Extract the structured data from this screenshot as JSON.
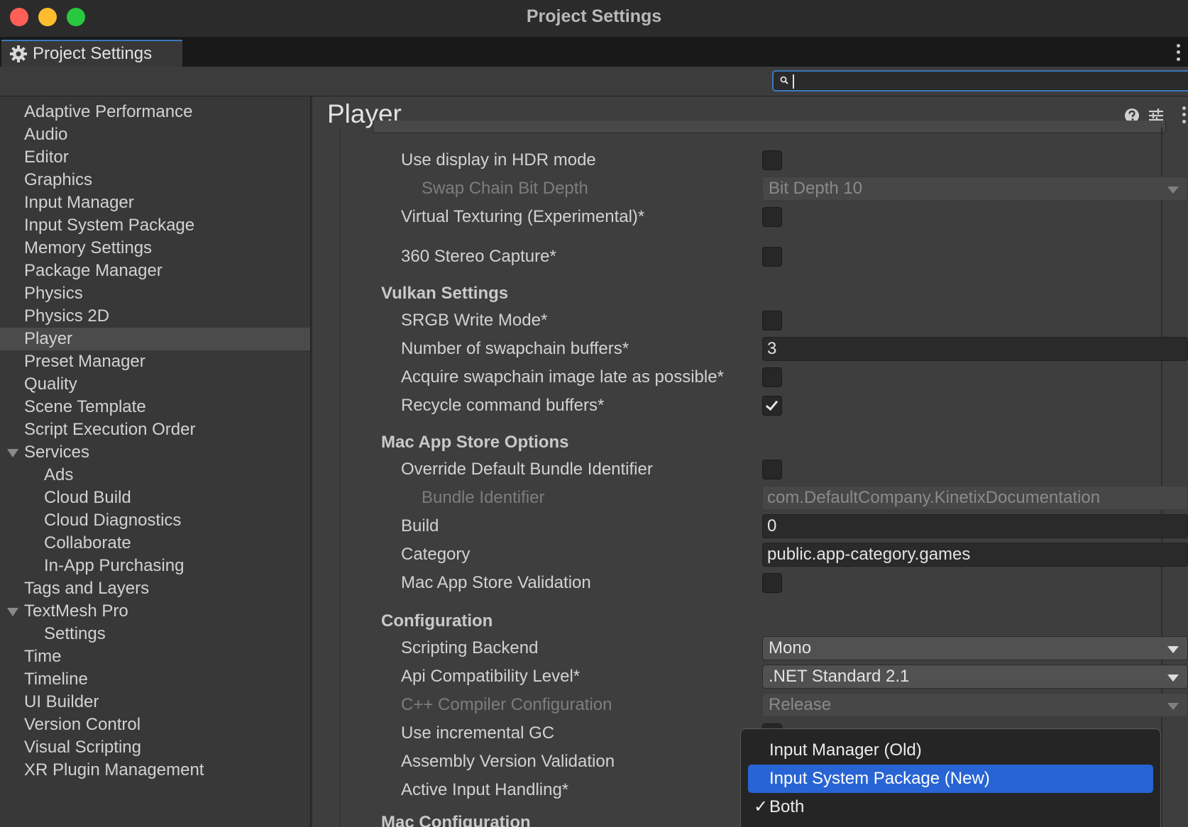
{
  "window": {
    "title": "Project Settings"
  },
  "tab": {
    "label": "Project Settings"
  },
  "sidebar": {
    "items": [
      {
        "label": "Adaptive Performance"
      },
      {
        "label": "Audio"
      },
      {
        "label": "Editor"
      },
      {
        "label": "Graphics"
      },
      {
        "label": "Input Manager"
      },
      {
        "label": "Input System Package"
      },
      {
        "label": "Memory Settings"
      },
      {
        "label": "Package Manager"
      },
      {
        "label": "Physics"
      },
      {
        "label": "Physics 2D"
      },
      {
        "label": "Player"
      },
      {
        "label": "Preset Manager"
      },
      {
        "label": "Quality"
      },
      {
        "label": "Scene Template"
      },
      {
        "label": "Script Execution Order"
      },
      {
        "label": "Services"
      },
      {
        "label": "Ads"
      },
      {
        "label": "Cloud Build"
      },
      {
        "label": "Cloud Diagnostics"
      },
      {
        "label": "Collaborate"
      },
      {
        "label": "In-App Purchasing"
      },
      {
        "label": "Tags and Layers"
      },
      {
        "label": "TextMesh Pro"
      },
      {
        "label": "Settings"
      },
      {
        "label": "Time"
      },
      {
        "label": "Timeline"
      },
      {
        "label": "UI Builder"
      },
      {
        "label": "Version Control"
      },
      {
        "label": "Visual Scripting"
      },
      {
        "label": "XR Plugin Management"
      }
    ],
    "selected": "Player"
  },
  "main": {
    "title": "Player",
    "rows": {
      "hdr": {
        "label": "Use display in HDR mode",
        "checked": false
      },
      "swap_chain": {
        "label": "Swap Chain Bit Depth",
        "value": "Bit Depth 10"
      },
      "virtual_texturing": {
        "label": "Virtual Texturing (Experimental)*",
        "checked": false
      },
      "stereo_capture": {
        "label": "360 Stereo Capture*",
        "checked": false
      },
      "srgb": {
        "label": "SRGB Write Mode*",
        "checked": false
      },
      "swapchain_buffers": {
        "label": "Number of swapchain buffers*",
        "value": "3"
      },
      "acquire_late": {
        "label": "Acquire swapchain image late as possible*",
        "checked": false
      },
      "recycle": {
        "label": "Recycle command buffers*",
        "checked": true
      },
      "override_bundle": {
        "label": "Override Default Bundle Identifier",
        "checked": false
      },
      "bundle_id": {
        "label": "Bundle Identifier",
        "value": "com.DefaultCompany.KinetixDocumentation"
      },
      "build": {
        "label": "Build",
        "value": "0"
      },
      "category": {
        "label": "Category",
        "value": "public.app-category.games"
      },
      "mas_validation": {
        "label": "Mac App Store Validation",
        "checked": false
      },
      "scripting_backend": {
        "label": "Scripting Backend",
        "value": "Mono"
      },
      "api_level": {
        "label": "Api Compatibility Level*",
        "value": ".NET Standard 2.1"
      },
      "cpp_config": {
        "label": "C++ Compiler Configuration",
        "value": "Release"
      },
      "incremental_gc": {
        "label": "Use incremental GC"
      },
      "assembly_validation": {
        "label": "Assembly Version Validation"
      },
      "active_input": {
        "label": "Active Input Handling*"
      }
    },
    "sections": {
      "vulkan": "Vulkan Settings",
      "mac_app_store": "Mac App Store Options",
      "configuration": "Configuration",
      "mac_configuration": "Mac Configuration"
    }
  },
  "popup": {
    "options": [
      "Input Manager (Old)",
      "Input System Package (New)",
      "Both"
    ],
    "highlighted": "Input System Package (New)",
    "selected": "Both",
    "check_glyph": "✓"
  },
  "colors": {
    "accent": "#3a79bb",
    "menu_highlight": "#2864d4"
  }
}
